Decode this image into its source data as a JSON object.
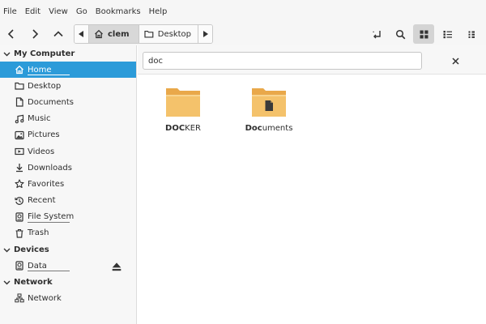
{
  "menubar": {
    "items": [
      "File",
      "Edit",
      "View",
      "Go",
      "Bookmarks",
      "Help"
    ]
  },
  "toolbar": {
    "nav_icons": [
      "back-icon",
      "forward-icon",
      "up-icon"
    ],
    "breadcrumbs": [
      {
        "label": "clem",
        "icon": "home-icon",
        "active": true
      },
      {
        "label": "Desktop",
        "icon": "folder-icon",
        "active": false
      }
    ],
    "right_icons": [
      "open-terminal-icon",
      "search-icon",
      "icon-view-icon",
      "list-view-icon",
      "compact-view-icon"
    ]
  },
  "sidebar": {
    "sections": [
      {
        "title": "My Computer",
        "items": [
          {
            "label": "Home",
            "icon": "home-icon",
            "selected": true,
            "usage_bar": true
          },
          {
            "label": "Desktop",
            "icon": "folder-icon"
          },
          {
            "label": "Documents",
            "icon": "document-icon"
          },
          {
            "label": "Music",
            "icon": "music-icon"
          },
          {
            "label": "Pictures",
            "icon": "picture-icon"
          },
          {
            "label": "Videos",
            "icon": "video-icon"
          },
          {
            "label": "Downloads",
            "icon": "download-icon"
          },
          {
            "label": "Favorites",
            "icon": "star-icon"
          },
          {
            "label": "Recent",
            "icon": "recent-icon"
          },
          {
            "label": "File System",
            "icon": "drive-icon",
            "usage_bar": true
          },
          {
            "label": "Trash",
            "icon": "trash-icon"
          }
        ]
      },
      {
        "title": "Devices",
        "items": [
          {
            "label": "Data",
            "icon": "drive-icon",
            "usage_bar": true,
            "eject": true
          }
        ]
      },
      {
        "title": "Network",
        "items": [
          {
            "label": "Network",
            "icon": "network-icon"
          }
        ]
      }
    ]
  },
  "search": {
    "value": "doc"
  },
  "files": [
    {
      "match": "DOC",
      "rest": "KER",
      "icon": "folder-icon"
    },
    {
      "match": "Doc",
      "rest": "uments",
      "icon": "documents-folder-icon"
    }
  ],
  "colors": {
    "selection": "#2c9bd9",
    "folder": "#f4c26b",
    "folder_back": "#e9a84a",
    "toolbar_bg": "#f6f6f6",
    "sidebar_bg": "#f7f7f7"
  }
}
